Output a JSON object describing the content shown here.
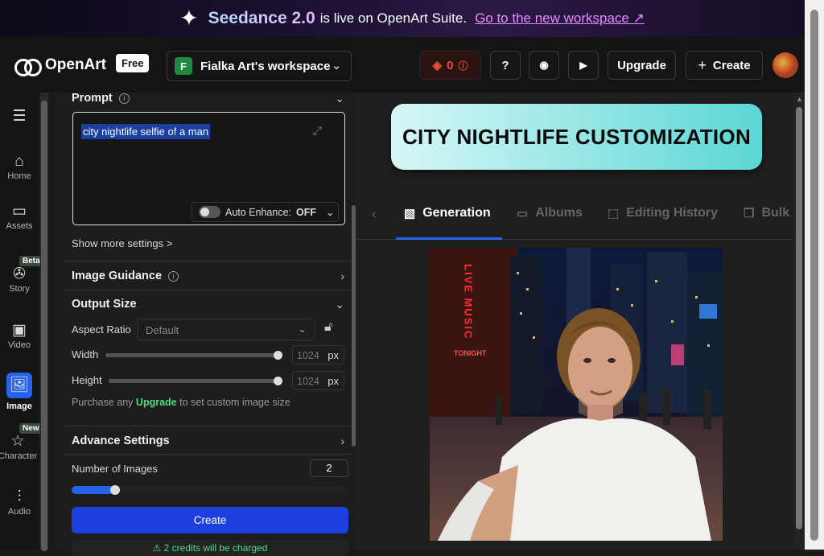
{
  "banner": {
    "brand": "Seedance 2.0",
    "message": "is live on OpenArt Suite.",
    "link": "Go to the new workspace ↗"
  },
  "header": {
    "logo": "OpenArt",
    "plan_badge": "Free",
    "workspace": {
      "initial": "F",
      "name": "Fialka Art's workspace"
    },
    "credits": "0",
    "upgrade_label": "Upgrade",
    "create_label": "Create"
  },
  "sidebar": {
    "items": [
      {
        "label": "Home",
        "icon": "home-icon"
      },
      {
        "label": "Assets",
        "icon": "folder-icon"
      },
      {
        "label": "Story",
        "icon": "film-reel-icon",
        "badge": "Beta"
      },
      {
        "label": "Video",
        "icon": "video-icon"
      },
      {
        "label": "Image",
        "icon": "image-icon",
        "active": true
      },
      {
        "label": "Character",
        "icon": "character-icon",
        "badge": "New"
      },
      {
        "label": "Audio",
        "icon": "audio-icon"
      }
    ]
  },
  "panel": {
    "prompt": {
      "title": "Prompt",
      "value": "city nightlife selfie of a man",
      "enhance_label": "Auto Enhance:",
      "enhance_state": "OFF",
      "more_settings": "Show more settings >"
    },
    "image_guidance": {
      "title": "Image Guidance"
    },
    "output_size": {
      "title": "Output Size",
      "aspect_label": "Aspect Ratio",
      "aspect_value": "Default",
      "width_label": "Width",
      "width_value": "1024",
      "height_label": "Height",
      "height_value": "1024",
      "unit": "px",
      "note_prefix": "Purchase any",
      "note_link": "Upgrade",
      "note_suffix": "to set custom image size"
    },
    "advance": {
      "title": "Advance Settings"
    },
    "num_images": {
      "label": "Number of Images",
      "value": "2",
      "fraction": 0.14
    },
    "create_label": "Create",
    "charge_note": "⚠ 2 credits will be charged"
  },
  "main": {
    "headline": "CITY NIGHTLIFE CUSTOMIZATION",
    "tabs": [
      {
        "label": "Generation",
        "active": true
      },
      {
        "label": "Albums"
      },
      {
        "label": "Editing History"
      },
      {
        "label": "Bulk"
      }
    ],
    "photo_sign": "LIVE MUSIC",
    "photo_sign2": "TONIGHT"
  },
  "colors": {
    "accent": "#2563eb",
    "upgrade_green": "#4ade80",
    "credit_red": "#e8523a"
  }
}
